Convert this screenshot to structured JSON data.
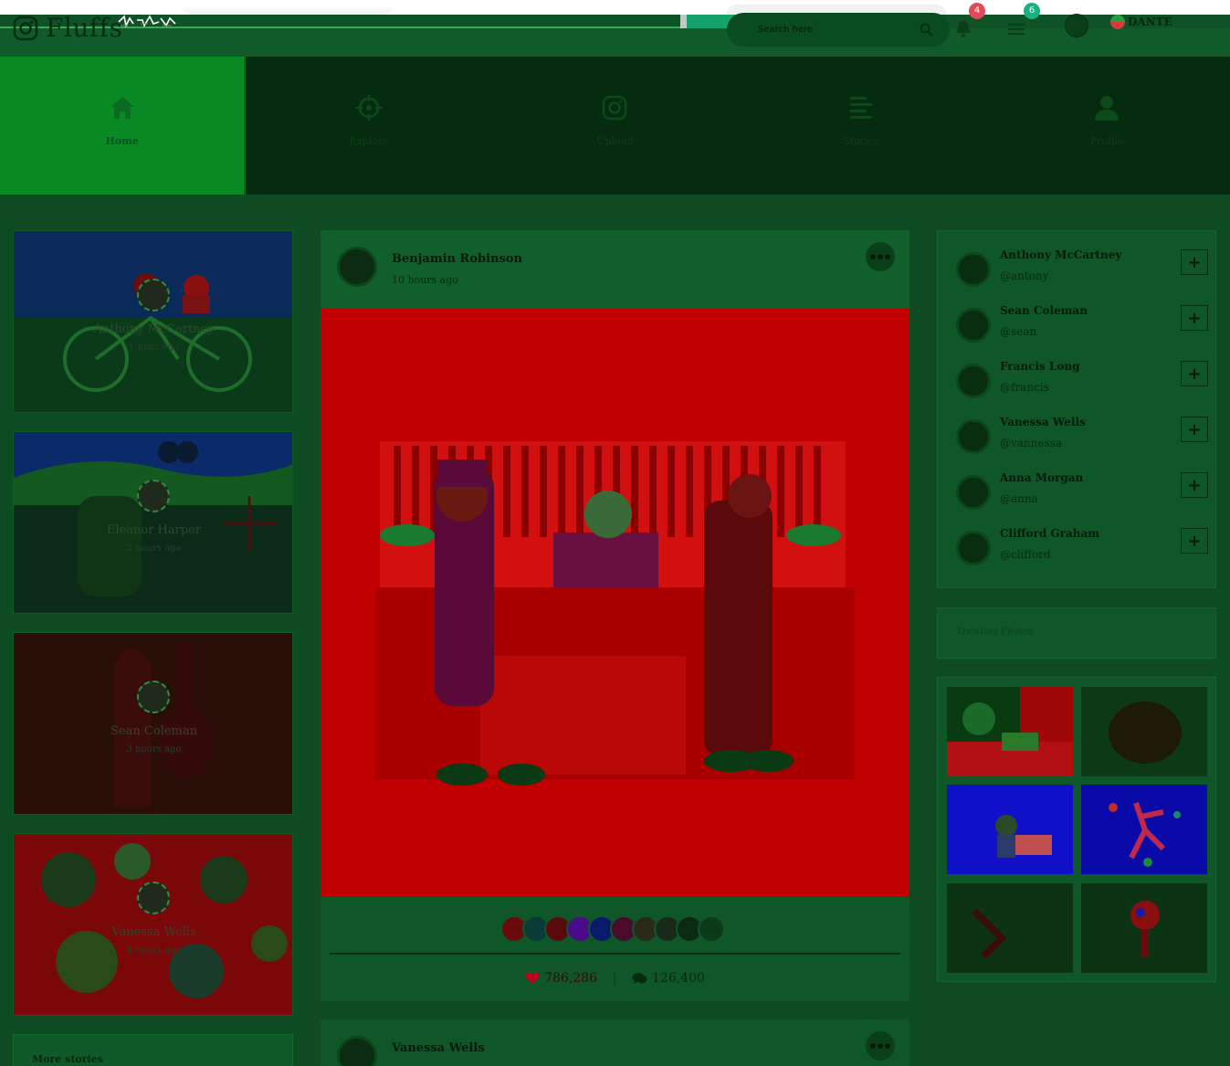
{
  "app": {
    "name": "Fluffs"
  },
  "header": {
    "search_placeholder": "Search here",
    "notifications_count": "4",
    "messages_count": "6",
    "language": "DANTE",
    "icons": [
      "bell-icon",
      "menu-icon",
      "user-avatar",
      "flag-icon"
    ]
  },
  "nav": {
    "items": [
      {
        "label": "Home",
        "icon": "home-icon",
        "active": true
      },
      {
        "label": "Explore",
        "icon": "crosshair-icon",
        "active": false
      },
      {
        "label": "Upload",
        "icon": "camera-icon",
        "active": false
      },
      {
        "label": "Stories",
        "icon": "lines-icon",
        "active": false
      },
      {
        "label": "Profile",
        "icon": "user-icon",
        "active": false
      }
    ]
  },
  "stories": [
    {
      "name": "Anthony McCartney",
      "time": "1 hour ago"
    },
    {
      "name": "Eleanor Harper",
      "time": "2 hours ago"
    },
    {
      "name": "Sean Coleman",
      "time": "3 hours ago"
    },
    {
      "name": "Vanessa Wells",
      "time": "4 hours ago"
    }
  ],
  "more_stories_label": "More stories",
  "post": {
    "author": "Benjamin Robinson",
    "time": "10 hours ago",
    "likes": "786,286",
    "comments": "126,400"
  },
  "post2": {
    "author": "Vanessa Wells"
  },
  "suggestions": [
    {
      "name": "Anthony McCartney",
      "handle": "@antony"
    },
    {
      "name": "Sean Coleman",
      "handle": "@sean"
    },
    {
      "name": "Francis Long",
      "handle": "@francis"
    },
    {
      "name": "Vanessa Wells",
      "handle": "@vannessa"
    },
    {
      "name": "Anna Morgan",
      "handle": "@anna"
    },
    {
      "name": "Clifford Graham",
      "handle": "@clifford"
    }
  ],
  "follow_label": "+",
  "trending_title": "Trending Photos",
  "colors": {
    "accent_green": "#0a8a25",
    "badge_red": "#e14b59",
    "badge_teal": "#19b27e"
  }
}
